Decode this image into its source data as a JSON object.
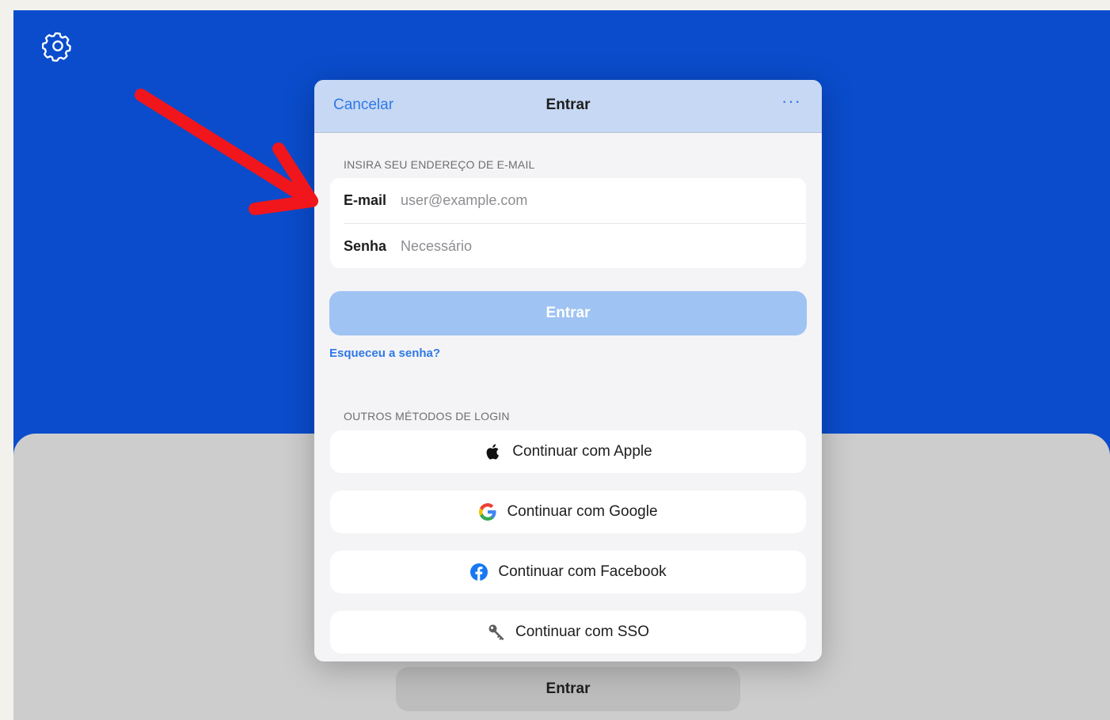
{
  "background": {
    "settings_icon": "gear-icon",
    "bottom_button_label": "Entrar",
    "colors": {
      "top": "#0a4ccc",
      "bottom_sheet": "#cdcdcd"
    }
  },
  "modal": {
    "header": {
      "cancel_label": "Cancelar",
      "title": "Entrar",
      "more_label": "···"
    },
    "email_section": {
      "heading": "INSIRA SEU ENDEREÇO DE E-MAIL",
      "email_label": "E-mail",
      "email_placeholder": "user@example.com",
      "password_label": "Senha",
      "password_placeholder": "Necessário"
    },
    "sign_in_button_label": "Entrar",
    "forgot_password_label": "Esqueceu a senha?",
    "other_methods": {
      "heading": "OUTROS MÉTODOS DE LOGIN",
      "providers": [
        {
          "label": "Continuar com Apple",
          "icon": "apple-icon"
        },
        {
          "label": "Continuar com Google",
          "icon": "google-icon"
        },
        {
          "label": "Continuar com Facebook",
          "icon": "facebook-icon"
        },
        {
          "label": "Continuar com SSO",
          "icon": "key-icon"
        }
      ]
    },
    "colors": {
      "accent": "#2f78e6",
      "primary_button": "#9fc3f2",
      "header": "#c6d8f3"
    }
  },
  "annotation": {
    "arrow_color": "#f0161c"
  }
}
